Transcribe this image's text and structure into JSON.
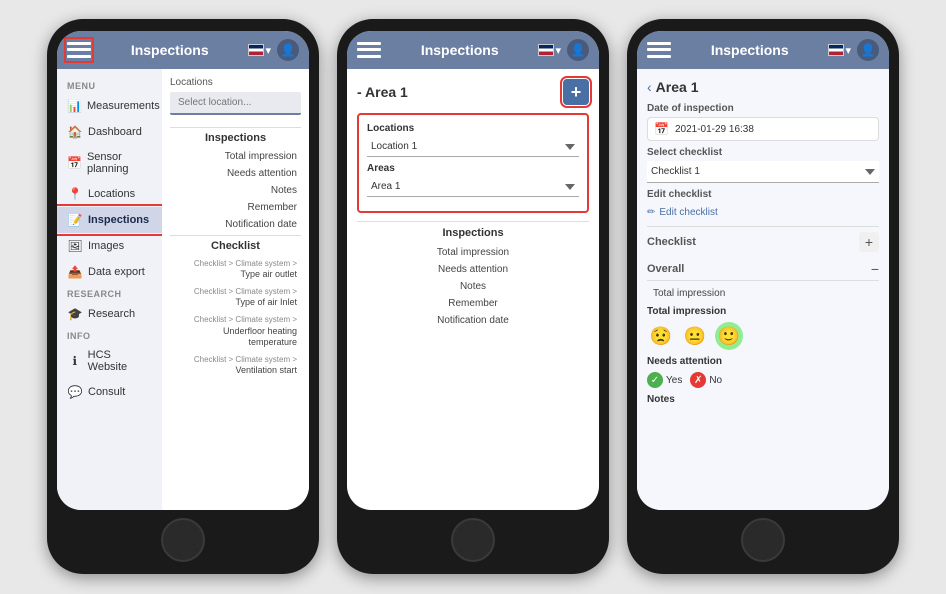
{
  "app": {
    "title": "Inspections",
    "flag_label": "🇬🇧",
    "flag_dropdown": "▾"
  },
  "phone1": {
    "header": {
      "title": "Inspections",
      "menu_label": "≡"
    },
    "sidebar": {
      "menu_label": "MENU",
      "items": [
        {
          "label": "Measurements",
          "icon": "📊"
        },
        {
          "label": "Dashboard",
          "icon": "🏠"
        },
        {
          "label": "Sensor planning",
          "icon": "📅"
        },
        {
          "label": "Locations",
          "icon": "📍"
        },
        {
          "label": "Inspections",
          "icon": "📝"
        },
        {
          "label": "Images",
          "icon": "🖼"
        },
        {
          "label": "Data export",
          "icon": "📤"
        }
      ],
      "research_label": "RESEARCH",
      "research_items": [
        {
          "label": "Research",
          "icon": "🎓"
        }
      ],
      "info_label": "INFO",
      "info_items": [
        {
          "label": "HCS Website",
          "icon": "ℹ"
        },
        {
          "label": "Consult",
          "icon": "💬"
        }
      ]
    },
    "content": {
      "locations_label": "Locations",
      "location_placeholder": "Select location...",
      "inspections_label": "Inspections",
      "inspection_rows": [
        "Total impression",
        "Needs attention",
        "Notes",
        "Remember",
        "Notification date"
      ],
      "checklist_label": "Checklist",
      "checklist_items": [
        {
          "path": "Checklist > Climate system >",
          "name": "Type air outlet"
        },
        {
          "path": "Checklist > Climate system >",
          "name": "Type of air Inlet"
        },
        {
          "path": "Checklist > Climate system >",
          "name": "Underfloor heating temperature"
        },
        {
          "path": "Checklist > Climate system >",
          "name": "Ventilation start"
        }
      ]
    }
  },
  "phone2": {
    "header": {
      "title": "Inspections",
      "menu_label": "≡"
    },
    "area_title": "- Area 1",
    "add_btn_label": "+",
    "form": {
      "locations_label": "Locations",
      "location_value": "Location 1",
      "areas_label": "Areas",
      "area_value": "Area 1"
    },
    "inspections_label": "Inspections",
    "inspection_rows": [
      "Total impression",
      "Needs attention",
      "Notes",
      "Remember",
      "Notification date"
    ]
  },
  "phone3": {
    "header": {
      "title": "Inspections",
      "menu_label": "≡"
    },
    "back_label": "‹",
    "area_title": "Area 1",
    "date_of_inspection_label": "Date of inspection",
    "date_value": "2021-01-29 16:38",
    "select_checklist_label": "Select checklist",
    "checklist_value": "Checklist 1",
    "edit_checklist_label": "Edit checklist",
    "edit_pencil": "✏",
    "checklist_section_label": "Checklist",
    "checklist_plus": "+",
    "overall_label": "Overall",
    "overall_minus": "−",
    "total_impression_row": "Total impression",
    "total_impression_sub_label": "Total impression",
    "emoji_sad": "😟",
    "emoji_neutral": "😐",
    "emoji_happy": "🙂",
    "needs_attention_label": "Needs attention",
    "yes_label": "Yes",
    "no_label": "No",
    "notes_label": "Notes"
  }
}
